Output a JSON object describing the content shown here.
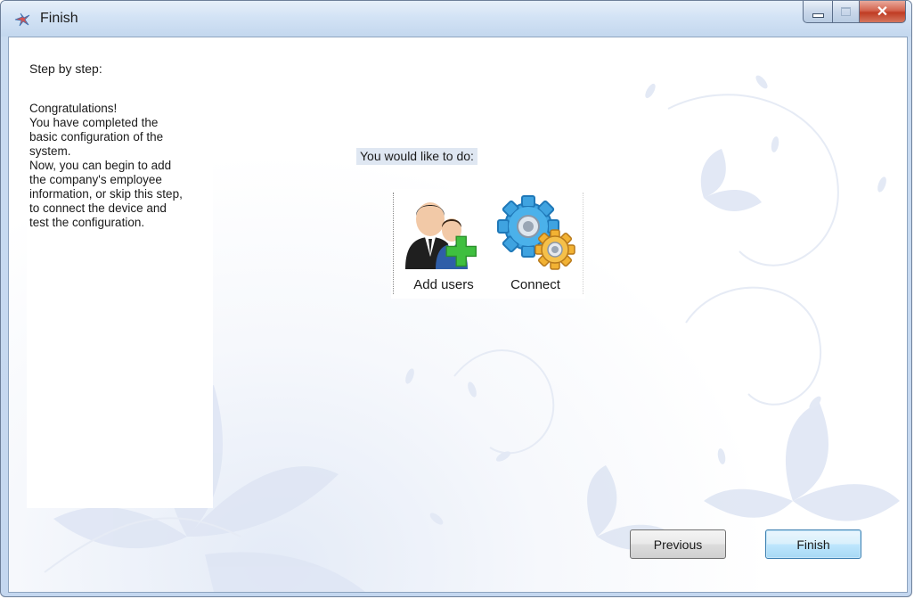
{
  "window": {
    "title": "Finish"
  },
  "left_panel": {
    "heading": "Step by step:",
    "lines": [
      "Congratulations!",
      "You have completed the",
      "basic configuration of the",
      "system.",
      "Now, you can begin to add",
      "the company's employee",
      "information, or skip this step,",
      "to connect the device and",
      "test the configuration."
    ]
  },
  "main": {
    "prompt": "You would like to do:",
    "actions": [
      {
        "label": "Add users",
        "icon": "add-users-icon"
      },
      {
        "label": "Connect",
        "icon": "gears-icon"
      }
    ]
  },
  "footer": {
    "previous_label": "Previous",
    "finish_label": "Finish"
  },
  "colors": {
    "titlebar": "#c4d7ef",
    "close_button": "#c03c23",
    "prompt_highlight": "#dfe7f2",
    "finish_border": "#3c7fb1"
  }
}
